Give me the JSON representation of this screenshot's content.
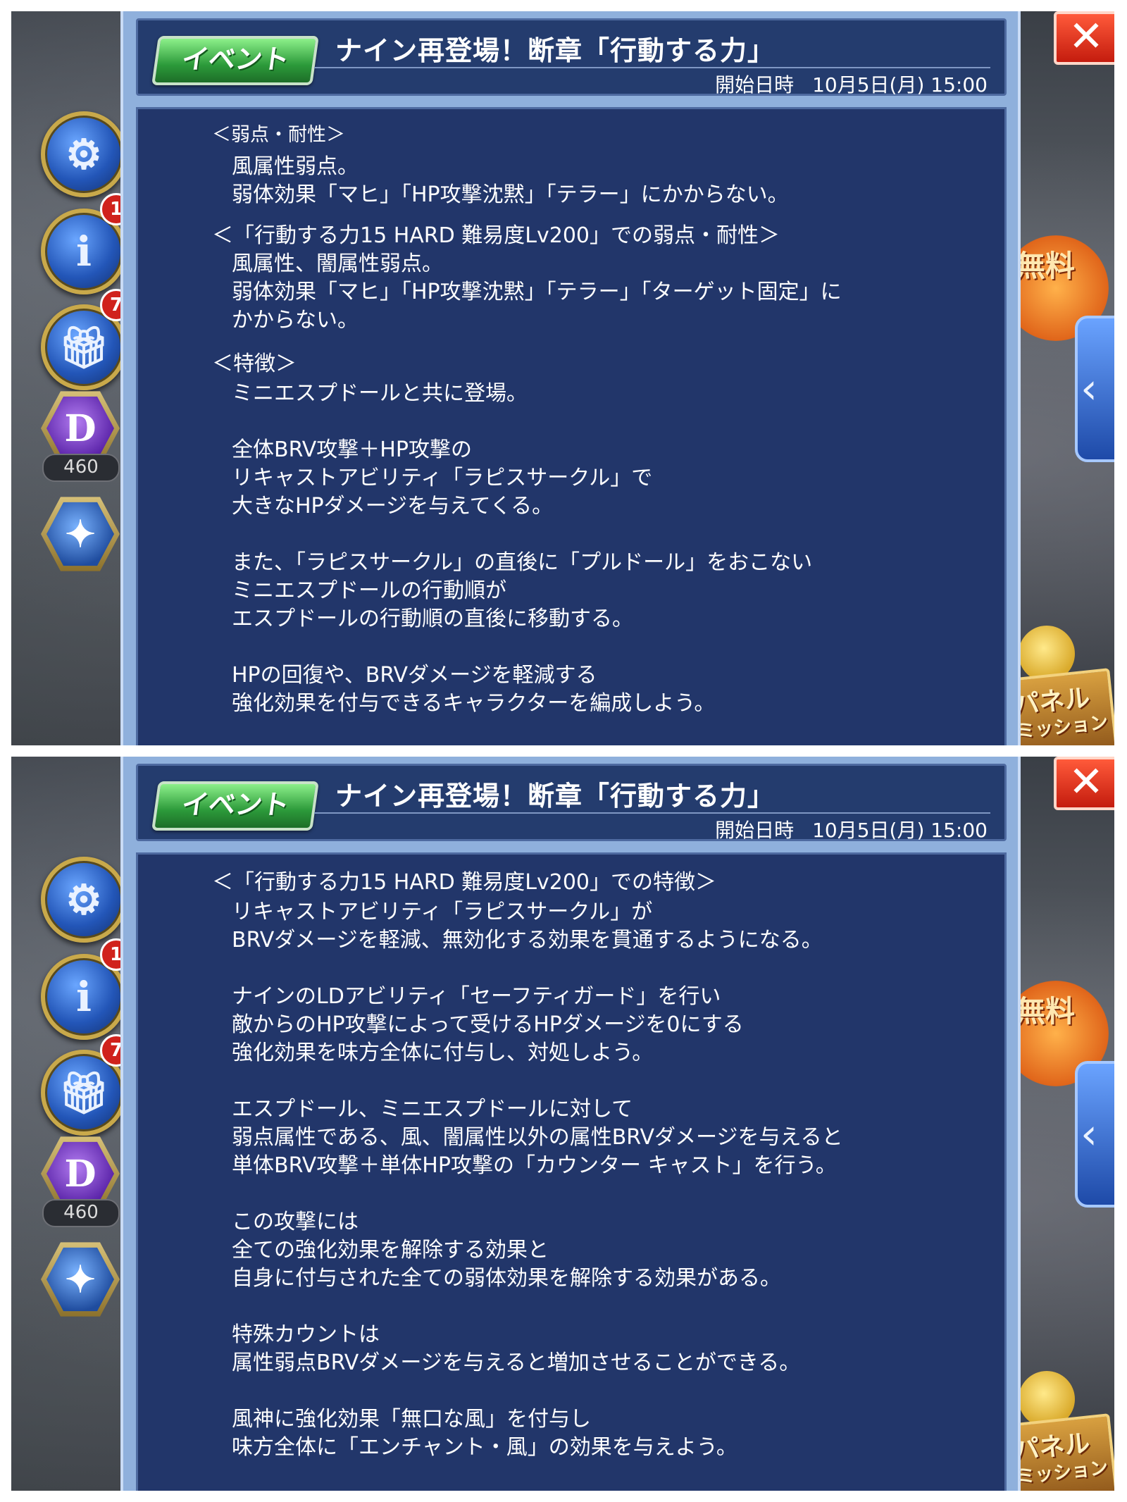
{
  "header": {
    "badge": "イベント",
    "title": "ナイン再登場！断章「行動する力」",
    "start_label": "開始日時",
    "start_value": "10月5日(月) 15:00"
  },
  "rail": {
    "settings_icon": "gear-icon",
    "info_icon": "info-icon",
    "info_badge": "1",
    "gift_icon": "gift-icon",
    "gift_badge": "7",
    "crystal_icon": "crystal-icon",
    "crystal_count": "460",
    "moogle_icon": "moogle-icon"
  },
  "right": {
    "close_icon": "close-icon",
    "close_symbol": "✕",
    "free_label": "無料",
    "side_tab_symbol": "‹",
    "panel_mission_l1": "パネル",
    "panel_mission_l2": "ミッション"
  },
  "panel1": {
    "lines": [
      "＜弱点・耐性＞",
      "風属性弱点。",
      "弱体効果「マヒ」「HP攻撃沈黙」「テラー」にかからない。",
      "＜「行動する力15 HARD 難易度Lv200」での弱点・耐性＞",
      "風属性、闇属性弱点。",
      "弱体効果「マヒ」「HP攻撃沈黙」「テラー」「ターゲット固定」に",
      "かからない。",
      "＜特徴＞",
      "ミニエスプドールと共に登場。",
      "全体BRV攻撃＋HP攻撃の",
      "リキャストアビリティ「ラピスサークル」で",
      "大きなHPダメージを与えてくる。",
      "また、「ラピスサークル」の直後に「プルドール」をおこない",
      "ミニエスプドールの行動順が",
      "エスプドールの行動順の直後に移動する。",
      "HPの回復や、BRVダメージを軽減する",
      "強化効果を付与できるキャラクターを編成しよう。"
    ]
  },
  "panel2": {
    "lines": [
      "＜「行動する力15 HARD 難易度Lv200」での特徴＞",
      "リキャストアビリティ「ラピスサークル」が",
      "BRVダメージを軽減、無効化する効果を貫通するようになる。",
      "ナインのLDアビリティ「セーフティガード」を行い",
      "敵からのHP攻撃によって受けるHPダメージを0にする",
      "強化効果を味方全体に付与し、対処しよう。",
      "エスプドール、ミニエスプドールに対して",
      "弱点属性である、風、闇属性以外の属性BRVダメージを与えると",
      "単体BRV攻撃＋単体HP攻撃の「カウンター キャスト」を行う。",
      "この攻撃には",
      "全ての強化効果を解除する効果と",
      "自身に付与された全ての弱体効果を解除する効果がある。",
      "特殊カウントは",
      "属性弱点BRVダメージを与えると増加させることができる。",
      "風神に強化効果「無口な風」を付与し",
      "味方全体に「エンチャント・風」の効果を与えよう。"
    ]
  }
}
